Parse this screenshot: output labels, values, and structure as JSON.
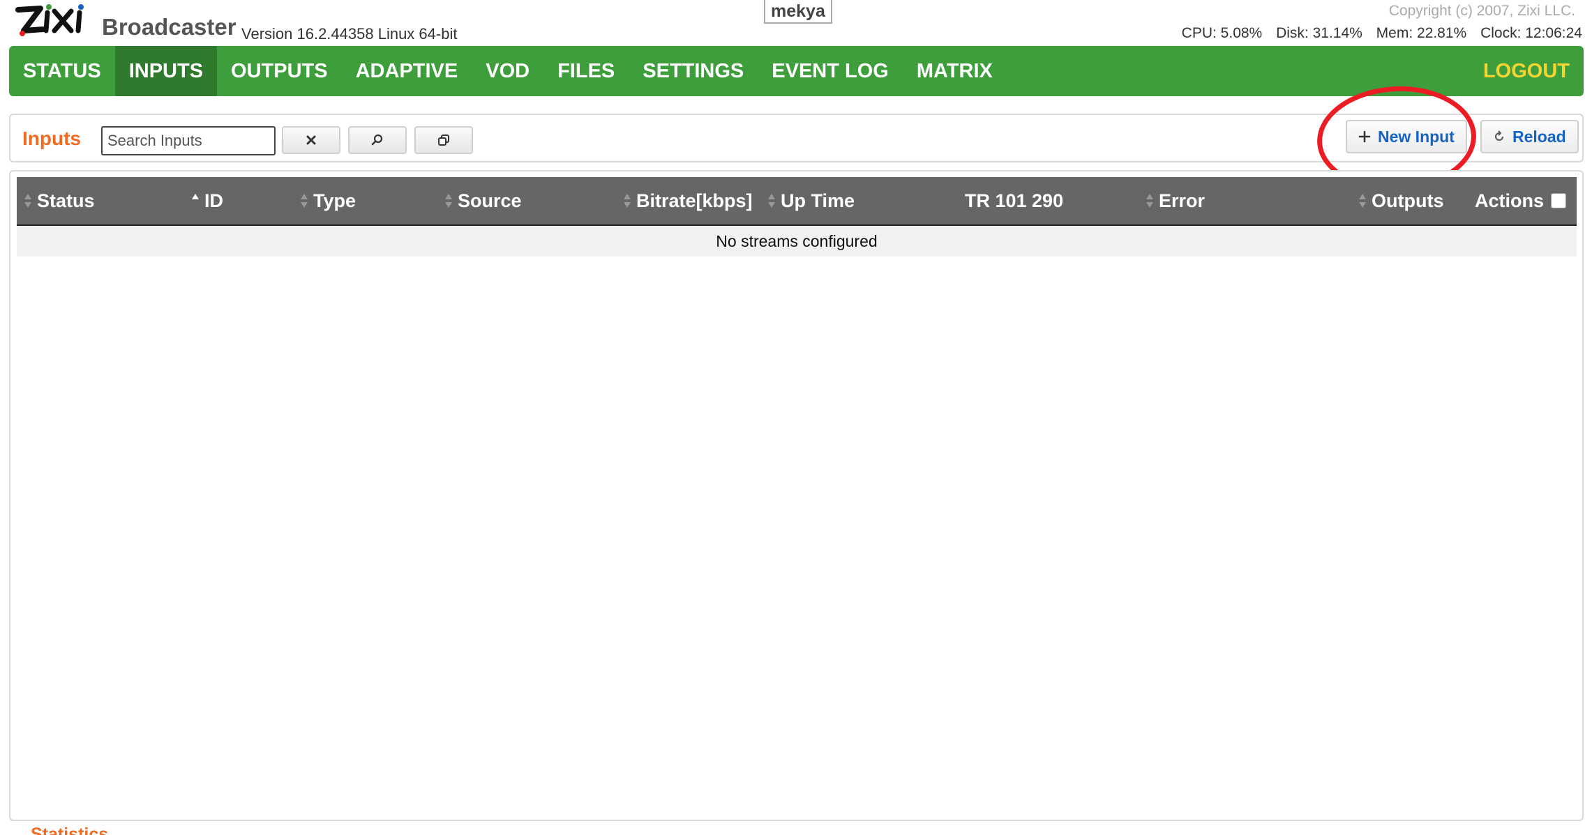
{
  "header": {
    "product": "Broadcaster",
    "version": "Version 16.2.44358 Linux 64-bit",
    "hostname": "mekya",
    "copyright": "Copyright (c) 2007, Zixi LLC.",
    "cpu": "CPU: 5.08%",
    "disk": "Disk: 31.14%",
    "mem": "Mem: 22.81%",
    "clock": "Clock: 12:06:24"
  },
  "nav": {
    "items": [
      "STATUS",
      "INPUTS",
      "OUTPUTS",
      "ADAPTIVE",
      "VOD",
      "FILES",
      "SETTINGS",
      "EVENT LOG",
      "MATRIX"
    ],
    "active": "INPUTS",
    "logout": "LOGOUT"
  },
  "toolbar": {
    "title": "Inputs",
    "search_placeholder": "Search Inputs",
    "new_input_label": "New Input",
    "reload_label": "Reload"
  },
  "table": {
    "columns": [
      "Status",
      "ID",
      "Type",
      "Source",
      "Bitrate[kbps]",
      "Up Time",
      "TR 101 290",
      "Error",
      "Outputs",
      "Actions"
    ],
    "empty_message": "No streams configured"
  },
  "footer": {
    "statistics_title": "Statistics"
  },
  "colors": {
    "nav_green": "#3f9e3c",
    "nav_active": "#2f7a2d",
    "logout_yellow": "#f5d531",
    "title_orange": "#f06c22",
    "link_blue": "#1763c5",
    "highlight_red": "#ec1c24"
  }
}
